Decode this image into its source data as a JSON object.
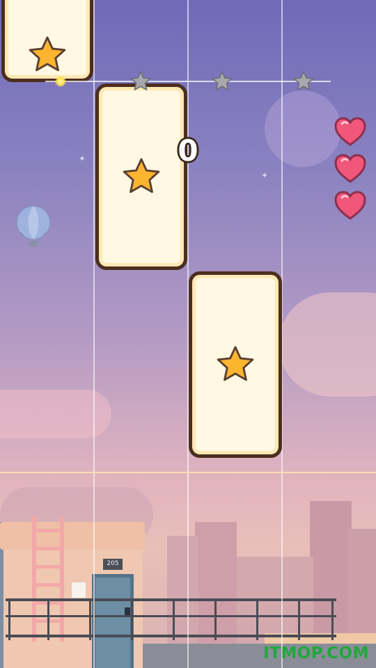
{
  "game": {
    "score": "0",
    "lives": 3,
    "progress_stars": 3
  },
  "watermark": "ITMOP.COM",
  "building": {
    "room_number": "205"
  },
  "colors": {
    "tile_fill": "#fff8e2",
    "tile_border": "#4b2e1e",
    "star_fill": "#fbb52f",
    "heart": "#f0577a",
    "watermark": "#1ea83c"
  },
  "icons": [
    "star-icon",
    "heart-icon",
    "hot-air-balloon-icon",
    "ladder-icon",
    "door-icon"
  ]
}
